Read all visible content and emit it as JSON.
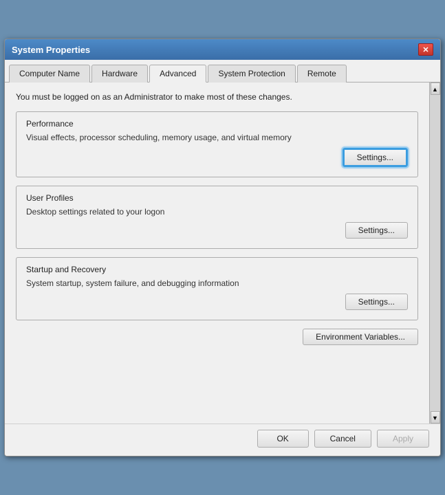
{
  "titleBar": {
    "title": "System Properties",
    "closeLabel": "✕"
  },
  "tabs": [
    {
      "id": "computer-name",
      "label": "Computer Name"
    },
    {
      "id": "hardware",
      "label": "Hardware"
    },
    {
      "id": "advanced",
      "label": "Advanced",
      "active": true
    },
    {
      "id": "system-protection",
      "label": "System Protection"
    },
    {
      "id": "remote",
      "label": "Remote"
    }
  ],
  "infoText": "You must be logged on as an Administrator to make most of these changes.",
  "groups": {
    "performance": {
      "label": "Performance",
      "description": "Visual effects, processor scheduling, memory usage, and virtual memory",
      "buttonLabel": "Settings...",
      "highlighted": true
    },
    "userProfiles": {
      "label": "User Profiles",
      "description": "Desktop settings related to your logon",
      "buttonLabel": "Settings...",
      "highlighted": false
    },
    "startupRecovery": {
      "label": "Startup and Recovery",
      "description": "System startup, system failure, and debugging information",
      "buttonLabel": "Settings...",
      "highlighted": false
    }
  },
  "environmentVariablesBtn": "Environment Variables...",
  "footer": {
    "ok": "OK",
    "cancel": "Cancel",
    "apply": "Apply"
  }
}
